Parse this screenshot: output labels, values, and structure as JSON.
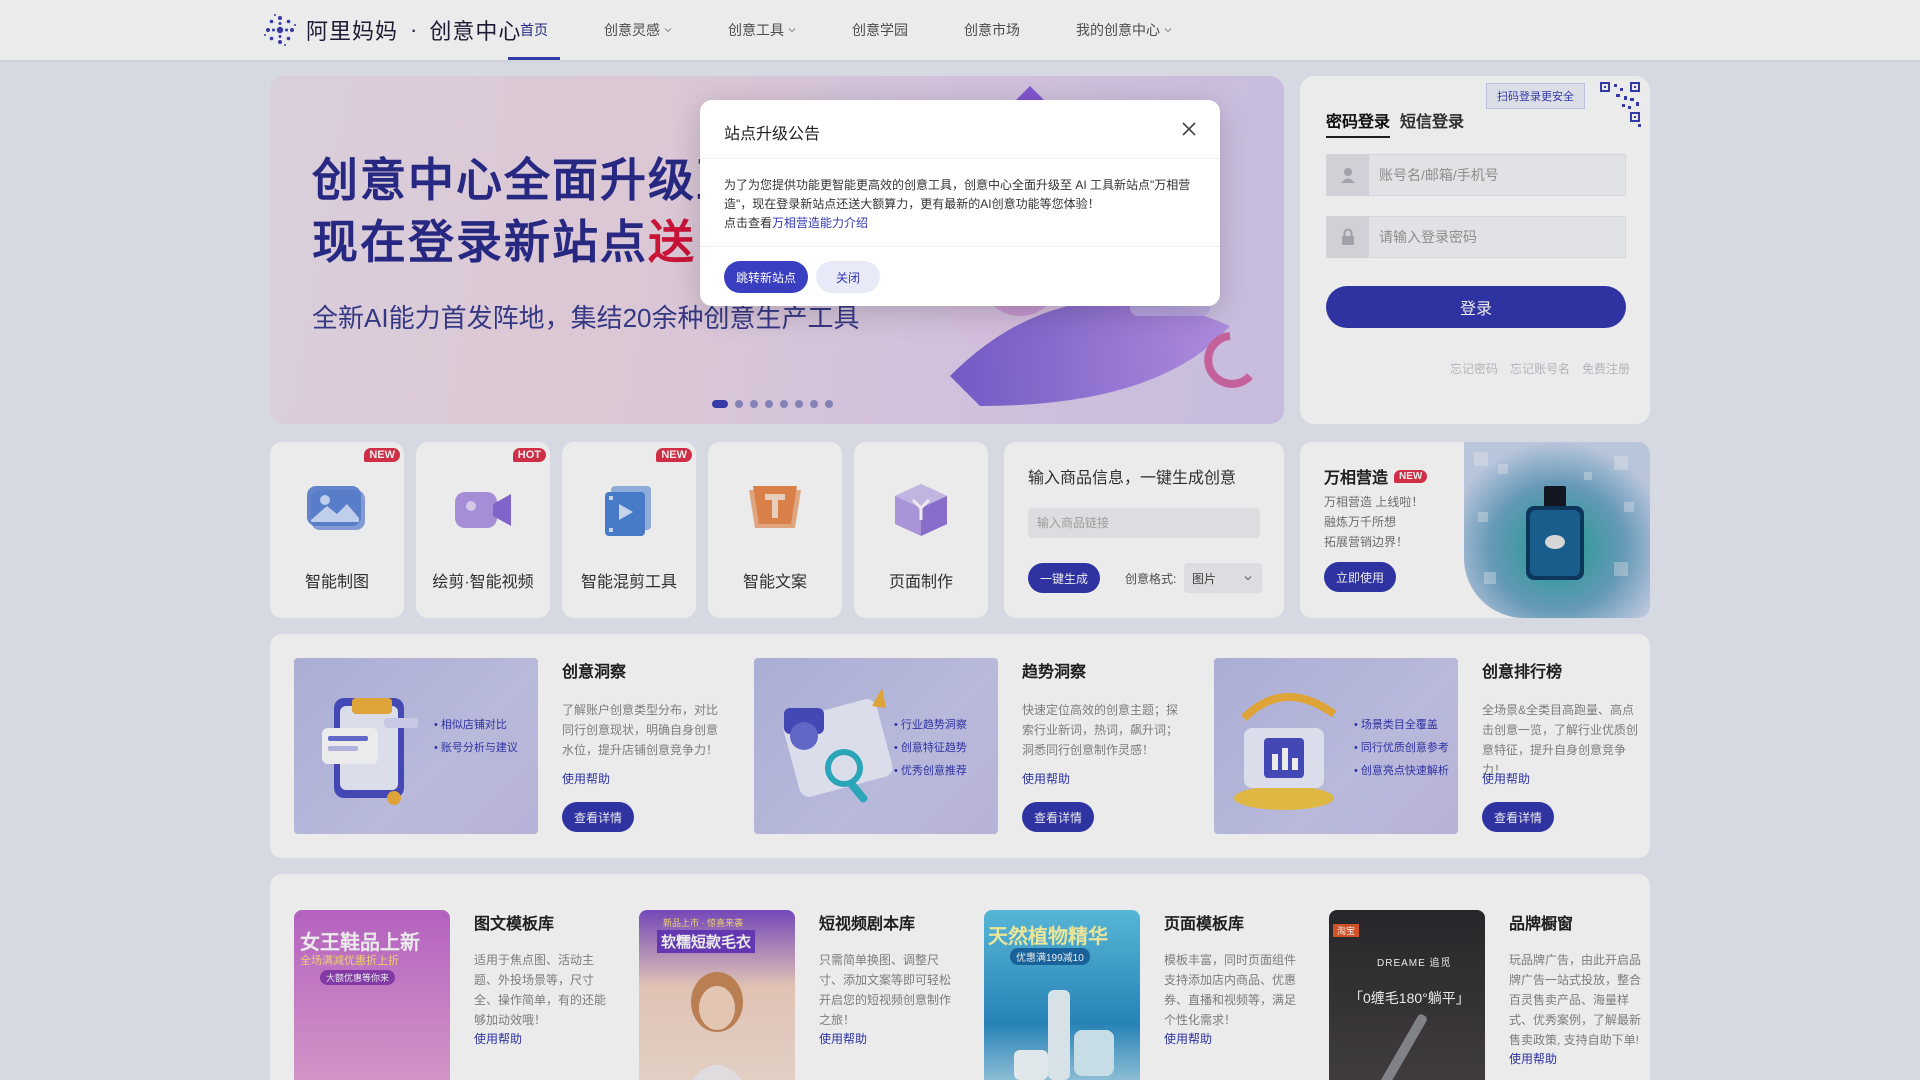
{
  "header": {
    "logo_text": "阿里妈妈",
    "logo_sep": "·",
    "logo_sub": "创意中心",
    "nav": [
      {
        "label": "首页"
      },
      {
        "label": "创意灵感"
      },
      {
        "label": "创意工具"
      },
      {
        "label": "创意学园"
      },
      {
        "label": "创意市场"
      },
      {
        "label": "我的创意中心"
      }
    ]
  },
  "banner": {
    "line1": "创意中心全面升级至",
    "line2_a": "现在登录新站点",
    "line2_b": "送",
    "subtitle": "全新AI能力首发阵地，集结20余种创意生产工具",
    "slides_total": 8,
    "slide_active": 1
  },
  "login": {
    "qr_tip": "扫码登录更安全",
    "tabs": [
      "密码登录",
      "短信登录"
    ],
    "account_placeholder": "账号名/邮箱/手机号",
    "password_placeholder": "请输入登录密码",
    "submit": "登录",
    "links": [
      "忘记密码",
      "忘记账号名",
      "免费注册"
    ]
  },
  "tools": [
    {
      "label": "智能制图",
      "badge": "NEW"
    },
    {
      "label": "绘剪·智能视频",
      "badge": "HOT"
    },
    {
      "label": "智能混剪工具",
      "badge": "NEW"
    },
    {
      "label": "智能文案",
      "badge": ""
    },
    {
      "label": "页面制作",
      "badge": ""
    }
  ],
  "generate": {
    "title": "输入商品信息，一键生成创意",
    "input_placeholder": "输入商品链接",
    "button": "一键生成",
    "format_label": "创意格式:",
    "format_value": "图片"
  },
  "wanxiang": {
    "title": "万相营造",
    "badge": "NEW",
    "desc": [
      "万相营造 上线啦！",
      "融炼万千所想",
      "拓展营销边界！"
    ],
    "button": "立即使用"
  },
  "insights": [
    {
      "title": "创意洞察",
      "desc": "了解账户创意类型分布，对比同行创意现状，明确自身创意水位，提升店铺创意竞争力！",
      "help": "使用帮助",
      "button": "查看详情",
      "bullets": [
        "相似店铺对比",
        "账号分析与建议"
      ]
    },
    {
      "title": "趋势洞察",
      "desc": "快速定位高效的创意主题；探索行业新词，热词，飙升词；洞悉同行创意制作灵感！",
      "help": "使用帮助",
      "button": "查看详情",
      "bullets": [
        "行业趋势洞察",
        "创意特征趋势",
        "优秀创意推荐"
      ]
    },
    {
      "title": "创意排行榜",
      "desc": "全场景&全类目高跑量、高点击创意一览，了解行业优质创意特征，提升自身创意竞争力！",
      "help": "使用帮助",
      "button": "查看详情",
      "bullets": [
        "场景类目全覆盖",
        "同行优质创意参考",
        "创意亮点快速解析"
      ]
    }
  ],
  "templates": [
    {
      "title": "图文模板库",
      "desc": "适用于焦点图、活动主题、外投场景等，尺寸全、操作简单，有的还能够加动效哦！",
      "help": "使用帮助",
      "img_text": [
        "女王鞋品上新",
        "全场满减优惠折上折",
        "大额优惠等你来"
      ]
    },
    {
      "title": "短视频剧本库",
      "desc": "只需简单换图、调整尺寸、添加文案等即可轻松开启您的短视频创意制作之旅！",
      "help": "使用帮助",
      "img_text": [
        "新品上市 · 惊喜来袭",
        "软糯短款毛衣"
      ]
    },
    {
      "title": "页面模板库",
      "desc": "模板丰富，同时页面组件支持添加店内商品、优惠券、直播和视频等，满足个性化需求！",
      "help": "使用帮助",
      "img_text": [
        "天然植物精华",
        "优惠满199减10"
      ]
    },
    {
      "title": "品牌橱窗",
      "desc": "玩品牌广告，由此开启品牌广告一站式投放，整合百灵售卖产品、海量样式、优秀案例，了解最新售卖政策, 支持自助下单!",
      "help": "使用帮助",
      "img_text": [
        "淘宝",
        "DREAME 追觅",
        "「0缠毛180°躺平」"
      ]
    }
  ],
  "modal": {
    "title": "站点升级公告",
    "body_line": "为了为您提供功能更智能更高效的创意工具，创意中心全面升级至 AI 工具新站点\"万相营造\"，现在登录新站点还送大额算力，更有最新的AI创意功能等您体验！",
    "body_prefix": "点击查看",
    "body_link": "万相营造能力介绍",
    "primary": "跳转新站点",
    "secondary": "关闭"
  },
  "colors": {
    "brand": "#3338b0",
    "badge": "#e0334e",
    "banner_highlight": "#d8163c"
  }
}
